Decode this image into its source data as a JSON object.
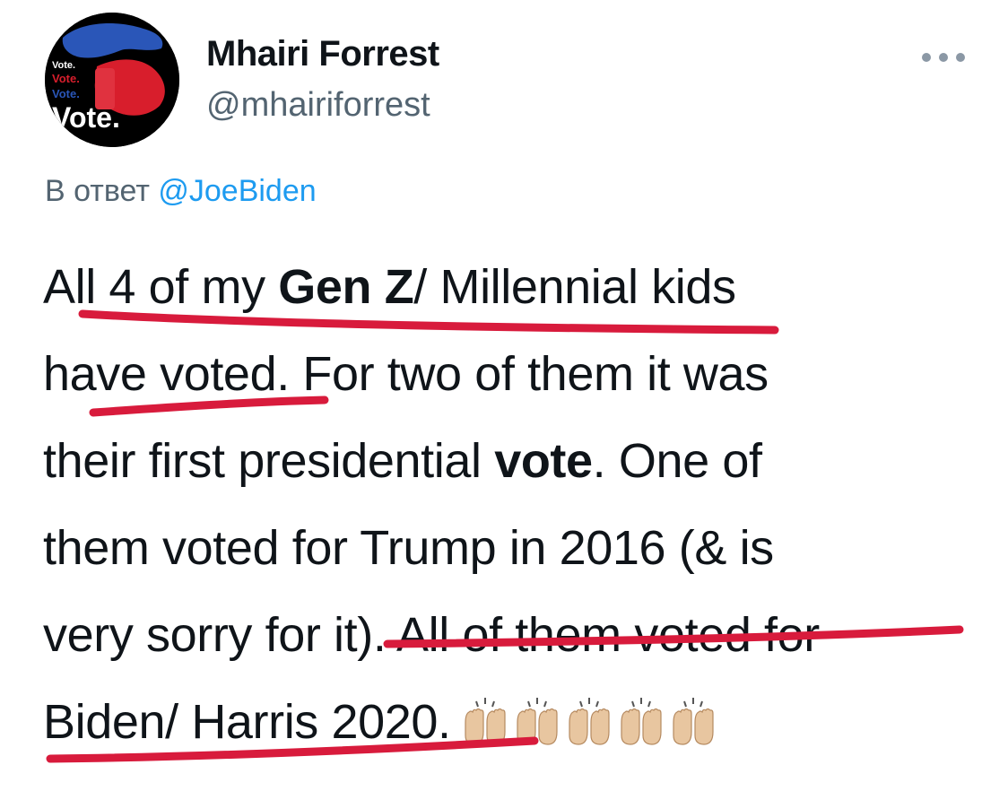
{
  "user": {
    "display_name": "Mhairi Forrest",
    "handle": "@mhairiforrest",
    "avatar_text": [
      "Vote.",
      "Vote.",
      "Vote.",
      "Vote."
    ]
  },
  "reply": {
    "prefix": "В ответ",
    "mention": "@JoeBiden"
  },
  "tweet": {
    "lines": [
      [
        "All 4 of my ",
        "Gen Z",
        "/ Millennial kids"
      ],
      [
        "have voted. For two of them it was"
      ],
      [
        "their first presidential ",
        "vote",
        ". One of"
      ],
      [
        "them voted for Trump in 2016 (& is"
      ],
      [
        "very sorry for it). All of them voted for"
      ],
      [
        "Biden/ Harris 2020."
      ]
    ],
    "emoji": "raising-hands-emoji",
    "emoji_count": 5
  },
  "colors": {
    "text": "#0f1419",
    "secondary": "#536471",
    "link": "#1d9bf0",
    "underline_marker": "#d81b3c",
    "emoji_skin": "#e8c6a0"
  }
}
